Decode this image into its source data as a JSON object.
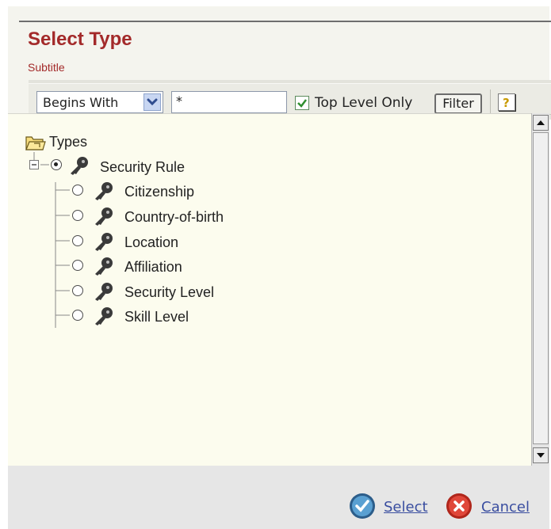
{
  "dialog": {
    "title": "Select Type",
    "subtitle": "Subtitle",
    "accent_color": "#a32a2a"
  },
  "toolbar": {
    "match_mode": "Begins With",
    "filter_value": "*",
    "top_level_only_checked": true,
    "top_level_only_label": "Top Level Only",
    "filter_button_label": "Filter",
    "help_icon": "help-icon"
  },
  "tree": {
    "root": {
      "label": "Types",
      "icon": "folder-icon"
    },
    "node": {
      "label": "Security Rule",
      "selected": true,
      "expanded": true,
      "icon": "key-icon",
      "children": [
        {
          "label": "Citizenship",
          "icon": "key-icon",
          "selected": false
        },
        {
          "label": "Country-of-birth",
          "icon": "key-icon",
          "selected": false
        },
        {
          "label": "Location",
          "icon": "key-icon",
          "selected": false
        },
        {
          "label": "Affiliation",
          "icon": "key-icon",
          "selected": false
        },
        {
          "label": "Security Level",
          "icon": "key-icon",
          "selected": false
        },
        {
          "label": "Skill Level",
          "icon": "key-icon",
          "selected": false
        }
      ]
    }
  },
  "footer": {
    "select_label": "Select",
    "cancel_label": "Cancel",
    "link_color": "#3a4ea0"
  }
}
